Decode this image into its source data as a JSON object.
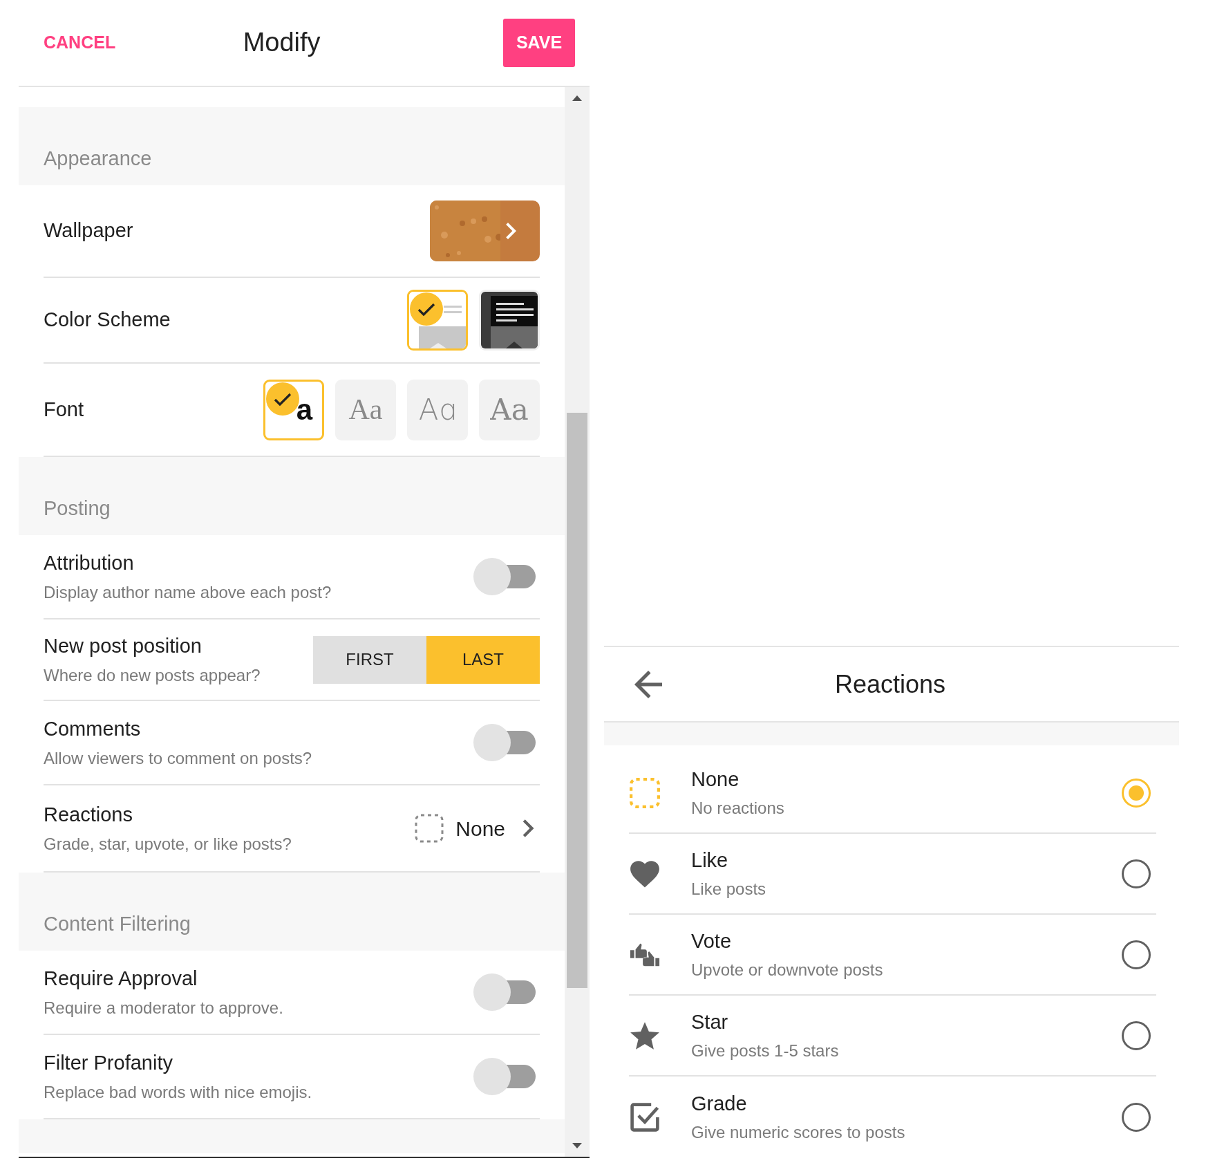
{
  "header": {
    "cancel": "CANCEL",
    "title": "Modify",
    "save": "SAVE"
  },
  "sections": [
    {
      "title": "Appearance",
      "rows": [
        {
          "kind": "wallpaper",
          "label": "Wallpaper"
        },
        {
          "kind": "swatches",
          "label": "Color Scheme",
          "options": [
            {
              "kind": "light",
              "selected": true
            },
            {
              "kind": "dark",
              "selected": false
            }
          ]
        },
        {
          "kind": "fonts",
          "label": "Font",
          "options": [
            {
              "kind": "sans",
              "sample": "a",
              "selected": true
            },
            {
              "kind": "serif",
              "sample": "Aa",
              "selected": false
            },
            {
              "kind": "light",
              "sample": "Aɑ",
              "selected": false
            },
            {
              "kind": "slab",
              "sample": "Aa",
              "selected": false
            }
          ]
        }
      ]
    },
    {
      "title": "Posting",
      "rows": [
        {
          "kind": "toggle",
          "label": "Attribution",
          "subtitle": "Display author name above each post?",
          "on": false
        },
        {
          "kind": "segmented",
          "label": "New post position",
          "subtitle": "Where do new posts appear?",
          "options": [
            {
              "label": "FIRST",
              "selected": false
            },
            {
              "label": "LAST",
              "selected": true
            }
          ]
        },
        {
          "kind": "toggle",
          "label": "Comments",
          "subtitle": "Allow viewers to comment on posts?",
          "on": false
        },
        {
          "kind": "link",
          "label": "Reactions",
          "subtitle": "Grade, star, upvote, or like posts?",
          "value": "None"
        }
      ]
    },
    {
      "title": "Content Filtering",
      "rows": [
        {
          "kind": "toggle",
          "label": "Require Approval",
          "subtitle": "Require a moderator to approve.",
          "on": false
        },
        {
          "kind": "toggle",
          "label": "Filter Profanity",
          "subtitle": "Replace bad words with nice emojis.",
          "on": false
        }
      ]
    }
  ],
  "reactions": {
    "title": "Reactions",
    "options": [
      {
        "kind": "none",
        "title": "None",
        "subtitle": "No reactions",
        "selected": true
      },
      {
        "kind": "like",
        "title": "Like",
        "subtitle": "Like posts",
        "selected": false
      },
      {
        "kind": "vote",
        "title": "Vote",
        "subtitle": "Upvote or downvote posts",
        "selected": false
      },
      {
        "kind": "star",
        "title": "Star",
        "subtitle": "Give posts 1-5 stars",
        "selected": false
      },
      {
        "kind": "grade",
        "title": "Grade",
        "subtitle": "Give numeric scores to posts",
        "selected": false
      }
    ]
  }
}
